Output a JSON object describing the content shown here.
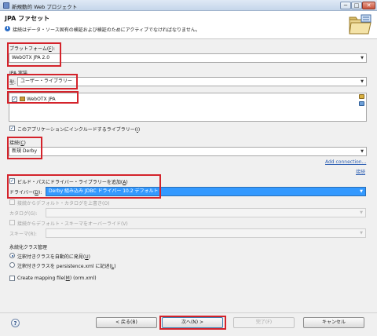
{
  "window": {
    "title": "新規動的 Web プロジェクト",
    "minimize": "─",
    "maximize": "□",
    "close": "✕"
  },
  "header": {
    "title": "JPA ファセット",
    "info_message": "接続はデータ・ソース固有の検証および検証のためにアクティブでなければなりません。",
    "info_glyph": "i"
  },
  "platform": {
    "label_prefix": "プラットフォーム(",
    "label_key": "F",
    "label_suffix": "):",
    "value": "WebOTX JPA 2.0"
  },
  "jpa_impl": {
    "group_label": "JPA 実装",
    "type_label_prefix": "型: ",
    "type_value": "ユーザー・ライブラリー",
    "libraries": [
      {
        "name": "WebOTX JPA",
        "checked": true
      }
    ],
    "include_library_label_prefix": "このアプリケーションにインクルードするライブラリー(",
    "include_library_label_key": "I",
    "include_library_label_suffix": ")",
    "include_library_checked": true
  },
  "connection": {
    "label_prefix": "接続(",
    "label_key": "C",
    "label_suffix": ")",
    "value": "新規 Derby",
    "add_link": "Add connection...",
    "connect_link": "接続"
  },
  "driver": {
    "add_to_path_label_prefix": "ビルド・パスにドライバー・ライブラリーを追加(",
    "add_to_path_label_key": "A",
    "add_to_path_label_suffix": ")",
    "add_to_path_checked": true,
    "driver_label_prefix": "ドライバー(",
    "driver_label_key": "D",
    "driver_label_suffix": "):",
    "driver_value": "Derby 組み込み JDBC ドライバー 10.2 デフォルト"
  },
  "catalog": {
    "override_label": "接続からデフォルト・カタログを上書き(O)",
    "override_checked": false,
    "catalog_label": "カタログ(G):",
    "catalog_value": ""
  },
  "schema": {
    "override_label": "接続からデフォルト・スキーマをオーバーライド(V)",
    "override_checked": false,
    "schema_label": "スキーマ(R):",
    "schema_value": ""
  },
  "persistent_class": {
    "group_label": "永続化クラス管理",
    "options": [
      {
        "label_prefix": "注釈付きクラスを自動的に発見(",
        "label_key": "U",
        "label_suffix": ")",
        "selected": true
      },
      {
        "label_prefix": "注釈付きクラスを persistence.xml に記述(",
        "label_key": "L",
        "label_suffix": ")",
        "selected": false
      }
    ]
  },
  "orm": {
    "label_prefix": "Create mapping file(",
    "label_key": "M",
    "label_suffix": ") (orm.xml)",
    "checked": false
  },
  "footer": {
    "help_glyph": "?",
    "back_label": "< 戻る(B)",
    "next_label": "次へ(N) >",
    "finish_label": "完了(F)",
    "cancel_label": "キャンセル"
  },
  "colors": {
    "highlight": "#d4232b",
    "selection": "#3399ff",
    "link": "#2d5fb3"
  },
  "icons": {
    "banner": "jpa-folder-wizard-icon",
    "library": "library-jar-icon",
    "add_library": "add-library-icon",
    "download_library": "download-library-icon"
  }
}
